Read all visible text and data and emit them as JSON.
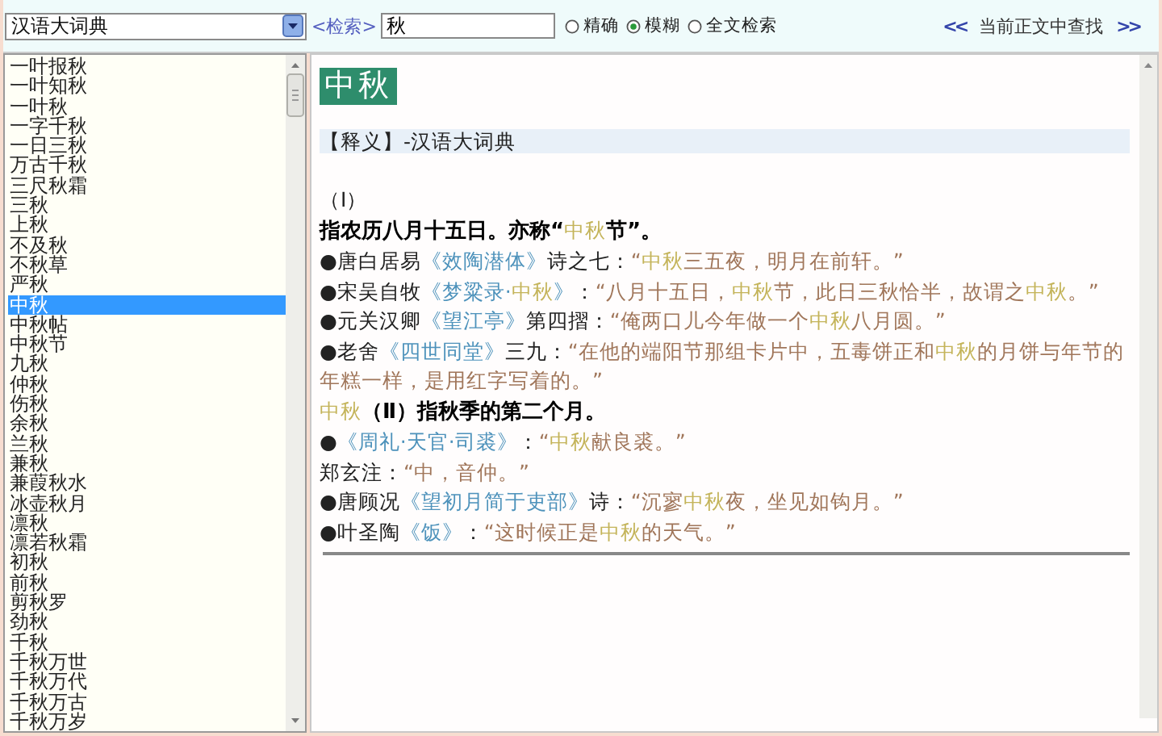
{
  "toolbar": {
    "dictionary": "汉语大词典",
    "search_label": "<检索>",
    "search_value": "秋",
    "modes": [
      {
        "label": "精确",
        "selected": false
      },
      {
        "label": "模糊",
        "selected": true
      },
      {
        "label": "全文检索",
        "selected": false
      }
    ],
    "find_prev": "<<",
    "find_label": "当前正文中查找",
    "find_next": ">>"
  },
  "word_list": {
    "items": [
      {
        "label": "一叶报秋",
        "selected": false
      },
      {
        "label": "一叶知秋",
        "selected": false
      },
      {
        "label": "一叶秋",
        "selected": false
      },
      {
        "label": "一字千秋",
        "selected": false
      },
      {
        "label": "一日三秋",
        "selected": false
      },
      {
        "label": "万古千秋",
        "selected": false
      },
      {
        "label": "三尺秋霜",
        "selected": false
      },
      {
        "label": "三秋",
        "selected": false
      },
      {
        "label": "上秋",
        "selected": false
      },
      {
        "label": "不及秋",
        "selected": false
      },
      {
        "label": "不秋草",
        "selected": false
      },
      {
        "label": "严秋",
        "selected": false
      },
      {
        "label": "中秋",
        "selected": true
      },
      {
        "label": "中秋帖",
        "selected": false
      },
      {
        "label": "中秋节",
        "selected": false
      },
      {
        "label": "九秋",
        "selected": false
      },
      {
        "label": "仲秋",
        "selected": false
      },
      {
        "label": "伤秋",
        "selected": false
      },
      {
        "label": "余秋",
        "selected": false
      },
      {
        "label": "兰秋",
        "selected": false
      },
      {
        "label": "兼秋",
        "selected": false
      },
      {
        "label": "兼葭秋水",
        "selected": false
      },
      {
        "label": "冰壶秋月",
        "selected": false
      },
      {
        "label": "凛秋",
        "selected": false
      },
      {
        "label": "凛若秋霜",
        "selected": false
      },
      {
        "label": "初秋",
        "selected": false
      },
      {
        "label": "前秋",
        "selected": false
      },
      {
        "label": "剪秋罗",
        "selected": false
      },
      {
        "label": "劲秋",
        "selected": false
      },
      {
        "label": "千秋",
        "selected": false
      },
      {
        "label": "千秋万世",
        "selected": false
      },
      {
        "label": "千秋万代",
        "selected": false
      },
      {
        "label": "千秋万古",
        "selected": false
      },
      {
        "label": "千秋万岁",
        "selected": false
      }
    ]
  },
  "entry": {
    "headword": "中秋",
    "section": "【释义】-汉语大词典",
    "lines": [
      {
        "segments": [
          {
            "kind": "plain",
            "text": "（Ⅰ）"
          }
        ]
      },
      {
        "segments": [
          {
            "kind": "bold",
            "text": "指农历八月十五日。亦称“"
          },
          {
            "kind": "term",
            "text": "中秋"
          },
          {
            "kind": "bold",
            "text": "节”。"
          }
        ]
      },
      {
        "segments": [
          {
            "kind": "plain",
            "text": "●唐白居易"
          },
          {
            "kind": "book",
            "text": "《效陶潜体》"
          },
          {
            "kind": "plain",
            "text": "诗之七："
          },
          {
            "kind": "quote",
            "text": "“"
          },
          {
            "kind": "term",
            "text": "中秋"
          },
          {
            "kind": "quote",
            "text": "三五夜，明月在前轩。”"
          }
        ]
      },
      {
        "segments": [
          {
            "kind": "plain",
            "text": "●宋吴自牧"
          },
          {
            "kind": "book",
            "text": "《梦粱录·"
          },
          {
            "kind": "term",
            "text": "中秋"
          },
          {
            "kind": "book",
            "text": "》"
          },
          {
            "kind": "plain",
            "text": "："
          },
          {
            "kind": "quote",
            "text": "“八月十五日，"
          },
          {
            "kind": "term",
            "text": "中秋"
          },
          {
            "kind": "quote",
            "text": "节，此日三秋恰半，故谓之"
          },
          {
            "kind": "term",
            "text": "中秋"
          },
          {
            "kind": "quote",
            "text": "。”"
          }
        ]
      },
      {
        "segments": [
          {
            "kind": "plain",
            "text": "●元关汉卿"
          },
          {
            "kind": "book",
            "text": "《望江亭》"
          },
          {
            "kind": "plain",
            "text": "第四摺："
          },
          {
            "kind": "quote",
            "text": "“俺两口儿今年做一个"
          },
          {
            "kind": "term",
            "text": "中秋"
          },
          {
            "kind": "quote",
            "text": "八月圆。”"
          }
        ]
      },
      {
        "segments": [
          {
            "kind": "plain",
            "text": "●老舍"
          },
          {
            "kind": "book",
            "text": "《四世同堂》"
          },
          {
            "kind": "plain",
            "text": "三九："
          },
          {
            "kind": "quote",
            "text": "“在他的端阳节那组卡片中，五毒饼正和"
          },
          {
            "kind": "term",
            "text": "中秋"
          },
          {
            "kind": "quote",
            "text": "的月饼与年节的年糕一样，是用红字写着的。”"
          }
        ]
      },
      {
        "segments": [
          {
            "kind": "term",
            "text": "中秋"
          },
          {
            "kind": "bold",
            "text": "（Ⅱ）指秋季的第二个月。"
          }
        ]
      },
      {
        "segments": [
          {
            "kind": "plain",
            "text": "●"
          },
          {
            "kind": "book",
            "text": "《周礼·天官·司裘》"
          },
          {
            "kind": "plain",
            "text": "："
          },
          {
            "kind": "quote",
            "text": "“"
          },
          {
            "kind": "term",
            "text": "中秋"
          },
          {
            "kind": "quote",
            "text": "献良裘。”"
          }
        ]
      },
      {
        "segments": [
          {
            "kind": "plain",
            "text": "郑玄注："
          },
          {
            "kind": "quote",
            "text": "“中，音仲。”"
          }
        ]
      },
      {
        "segments": [
          {
            "kind": "plain",
            "text": "●唐顾况"
          },
          {
            "kind": "book",
            "text": "《望初月简于吏部》"
          },
          {
            "kind": "plain",
            "text": "诗："
          },
          {
            "kind": "quote",
            "text": "“沉寥"
          },
          {
            "kind": "term",
            "text": "中秋"
          },
          {
            "kind": "quote",
            "text": "夜，坐见如钩月。”"
          }
        ]
      },
      {
        "segments": [
          {
            "kind": "plain",
            "text": "●叶圣陶"
          },
          {
            "kind": "book",
            "text": "《饭》"
          },
          {
            "kind": "plain",
            "text": "："
          },
          {
            "kind": "quote",
            "text": "“这时候正是"
          },
          {
            "kind": "term",
            "text": "中秋"
          },
          {
            "kind": "quote",
            "text": "的天气。”"
          }
        ]
      }
    ]
  }
}
